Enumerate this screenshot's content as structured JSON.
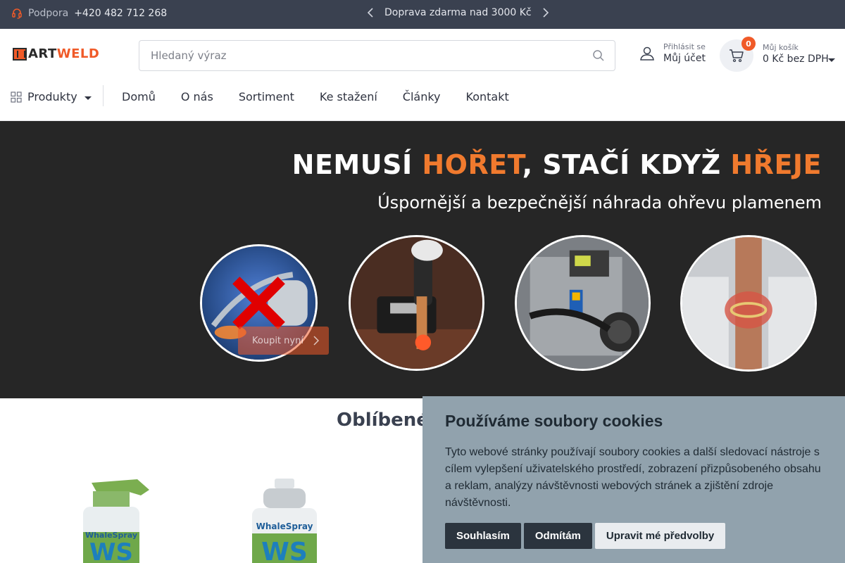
{
  "topbar": {
    "support_label": "Podpora",
    "support_phone": "+420 482 712 268",
    "promo_text": "Doprava zdarma nad 3000 Kč"
  },
  "header": {
    "logo_text_a": "ART",
    "logo_text_b": "WELD",
    "search_placeholder": "Hledaný výraz",
    "account_small": "Přihlásit se",
    "account_main": "Můj účet",
    "cart_small": "Můj košík",
    "cart_main": "0 Kč bez DPH",
    "cart_count": "0"
  },
  "nav": {
    "products": "Produkty",
    "links": [
      "Domů",
      "O nás",
      "Sortiment",
      "Ke stažení",
      "Články",
      "Kontakt"
    ]
  },
  "hero": {
    "title_1": "NEMUSÍ ",
    "title_hl_1": "HOŘET",
    "title_2": ", STAČÍ KDYŽ ",
    "title_hl_2": "HŘEJE",
    "subtitle": "Úspornější a bezpečnější náhrada ohřevu plamenem",
    "buy_label": "Koupit nyní"
  },
  "section": {
    "title": "Oblíbené"
  },
  "products": [
    {
      "brand": "WhaleSpray",
      "code": "WS"
    },
    {
      "brand": "WhaleSpray",
      "code": "WS"
    }
  ],
  "cookie": {
    "title": "Používáme soubory cookies",
    "text": "Tyto webové stránky používají soubory cookies a další sledovací nástroje s cílem vylepšení uživatelského prostředí, zobrazení přizpůsobeného obsahu a reklam, analýzy návštěvnosti webových stránek a zjištění zdroje návštěvnosti.",
    "accept": "Souhlasím",
    "reject": "Odmítám",
    "customize": "Upravit mé předvolby"
  },
  "colors": {
    "accent": "#f05a28",
    "topbar_bg": "#3a4150",
    "hero_bg": "#262626",
    "cookie_bg": "#91a2ad"
  }
}
